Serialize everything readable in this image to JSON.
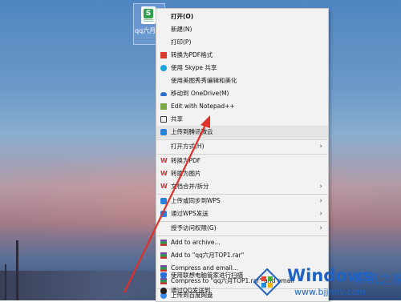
{
  "desktop": {
    "file": {
      "name": "qq六月TOP1",
      "icon": "spreadsheet-file-icon"
    }
  },
  "context_menu": {
    "items": [
      {
        "label": "打开(O)",
        "bold": true,
        "icon": ""
      },
      {
        "label": "新建(N)",
        "icon": ""
      },
      {
        "label": "打印(P)",
        "icon": ""
      },
      {
        "label": "转换为PDF格式",
        "icon": "pdf-icon"
      },
      {
        "label": "使用 Skype 共享",
        "icon": "skype-icon"
      },
      {
        "label": "使用美图秀秀编辑和美化",
        "icon": ""
      },
      {
        "label": "移动到 OneDrive(M)",
        "icon": "onedrive-icon"
      },
      {
        "label": "Edit with Notepad++",
        "icon": "notepad-icon"
      },
      {
        "label": "共享",
        "icon": "share-icon"
      },
      {
        "label": "上传到腾讯微云",
        "icon": "weiyun-icon",
        "highlight": true
      },
      {
        "label": "打开方式(H)",
        "icon": "",
        "submenu": true
      },
      {
        "label": "转换为PDF",
        "icon": "wps-icon"
      },
      {
        "label": "转换为图片",
        "icon": "wps-icon"
      },
      {
        "label": "文档合并/拆分",
        "icon": "wps-icon",
        "submenu": true
      },
      {
        "label": "上传或同步到WPS",
        "icon": "wps-cloud-icon",
        "submenu": true
      },
      {
        "label": "通过WPS发送",
        "icon": "wps-send-icon",
        "submenu": true
      },
      {
        "label": "授予访问权限(G)",
        "icon": "",
        "submenu": true
      },
      {
        "label": "Add to archive...",
        "icon": "winrar-icon"
      },
      {
        "label": "Add to \"qq六月TOP1.rar\"",
        "icon": "winrar-icon"
      },
      {
        "label": "Compress and email...",
        "icon": "winrar-icon"
      },
      {
        "label": "Compress to \"qq六月TOP1.rar\" and email",
        "icon": "winrar-icon"
      },
      {
        "label": "上传到百度网盘",
        "icon": "baidu-cloud-icon"
      },
      {
        "label": "使用联想电脑管家进行扫描",
        "icon": "lenovo-shield-icon"
      },
      {
        "label": "通过QQ发送到",
        "icon": "qq-icon"
      }
    ]
  },
  "watermark": {
    "brand": "Windows",
    "brand_cn": "系统之家",
    "url": "www.bjjmlv.com"
  },
  "colors": {
    "menu_bg": "#f2f2f2",
    "arrow": "#e0302a",
    "brand_blue": "#1e63c4"
  }
}
